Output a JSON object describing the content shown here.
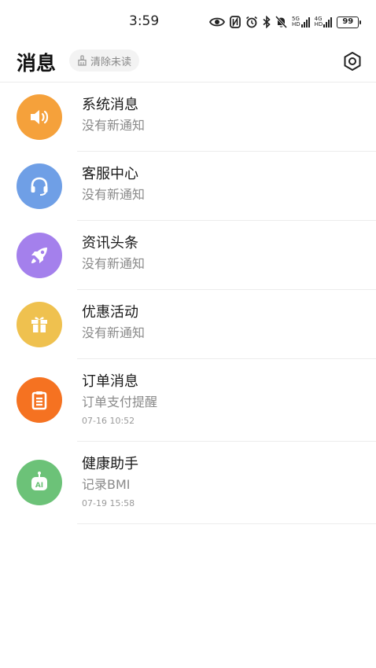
{
  "status_bar": {
    "time": "3:59",
    "net1": "5G",
    "net2": "4G",
    "battery": "99"
  },
  "header": {
    "title": "消息",
    "clear_unread": "清除未读",
    "icons": {
      "clear": "broom-icon",
      "settings": "settings-icon"
    }
  },
  "messages": [
    {
      "title": "系统消息",
      "subtitle": "没有新通知",
      "time": "",
      "icon": "speaker-icon",
      "color": "#f5a13b"
    },
    {
      "title": "客服中心",
      "subtitle": "没有新通知",
      "time": "",
      "icon": "headset-icon",
      "color": "#6f9fe6"
    },
    {
      "title": "资讯头条",
      "subtitle": "没有新通知",
      "time": "",
      "icon": "rocket-icon",
      "color": "#a480ec"
    },
    {
      "title": "优惠活动",
      "subtitle": "没有新通知",
      "time": "",
      "icon": "gift-icon",
      "color": "#efc14f"
    },
    {
      "title": "订单消息",
      "subtitle": "订单支付提醒",
      "time": "07-16 10:52",
      "icon": "document-icon",
      "color": "#f57221"
    },
    {
      "title": "健康助手",
      "subtitle": "记录BMI",
      "time": "07-19 15:58",
      "icon": "ai-robot-icon",
      "color": "#6cc278"
    }
  ]
}
